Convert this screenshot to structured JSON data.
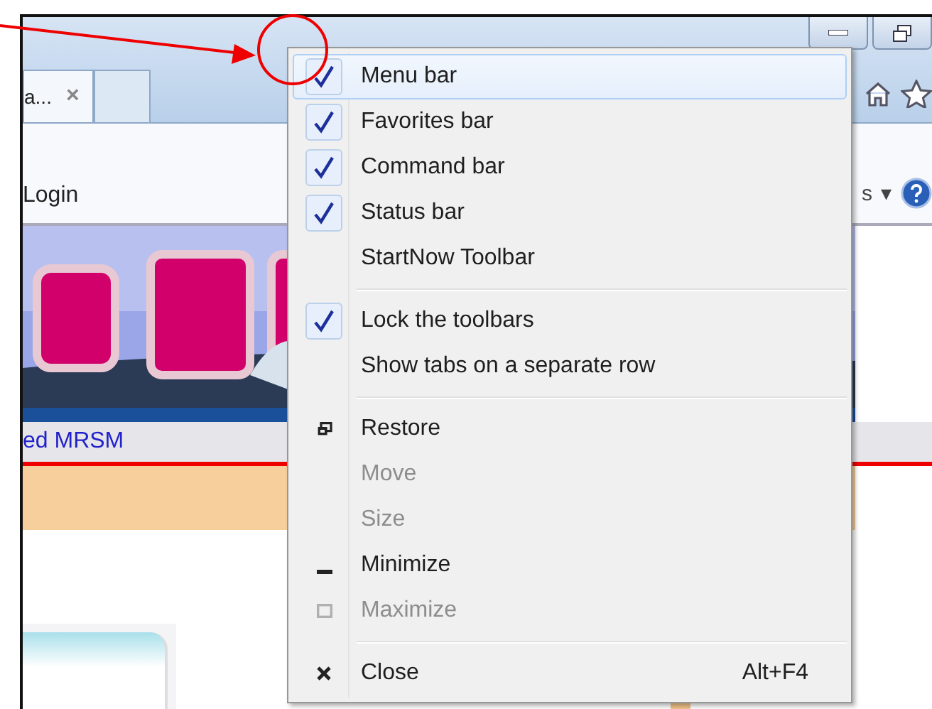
{
  "browser": {
    "tab": {
      "title": "a...",
      "close": "×"
    },
    "command_bar": {
      "login": "Login",
      "cut_label": "s",
      "dropdown": "▾"
    },
    "page": {
      "link": "ed MRSM"
    }
  },
  "context_menu": {
    "items": [
      {
        "kind": "check",
        "label": "Menu bar",
        "checked": true,
        "highlighted": true,
        "disabled": false
      },
      {
        "kind": "check",
        "label": "Favorites bar",
        "checked": true,
        "highlighted": false,
        "disabled": false
      },
      {
        "kind": "check",
        "label": "Command bar",
        "checked": true,
        "highlighted": false,
        "disabled": false
      },
      {
        "kind": "check",
        "label": "Status bar",
        "checked": true,
        "highlighted": false,
        "disabled": false
      },
      {
        "kind": "check",
        "label": "StartNow Toolbar",
        "checked": false,
        "highlighted": false,
        "disabled": false
      },
      {
        "kind": "separator"
      },
      {
        "kind": "check",
        "label": "Lock the toolbars",
        "checked": true,
        "highlighted": false,
        "disabled": false
      },
      {
        "kind": "check",
        "label": "Show tabs on a separate row",
        "checked": false,
        "highlighted": false,
        "disabled": false
      },
      {
        "kind": "separator"
      },
      {
        "kind": "restore",
        "label": "Restore",
        "highlighted": false,
        "disabled": false
      },
      {
        "kind": "plain",
        "label": "Move",
        "highlighted": false,
        "disabled": true
      },
      {
        "kind": "plain",
        "label": "Size",
        "highlighted": false,
        "disabled": true
      },
      {
        "kind": "minimize",
        "label": "Minimize",
        "highlighted": false,
        "disabled": false
      },
      {
        "kind": "maximize",
        "label": "Maximize",
        "highlighted": false,
        "disabled": true
      },
      {
        "kind": "separator"
      },
      {
        "kind": "close",
        "label": "Close",
        "shortcut": "Alt+F4",
        "highlighted": false,
        "disabled": false
      }
    ]
  }
}
